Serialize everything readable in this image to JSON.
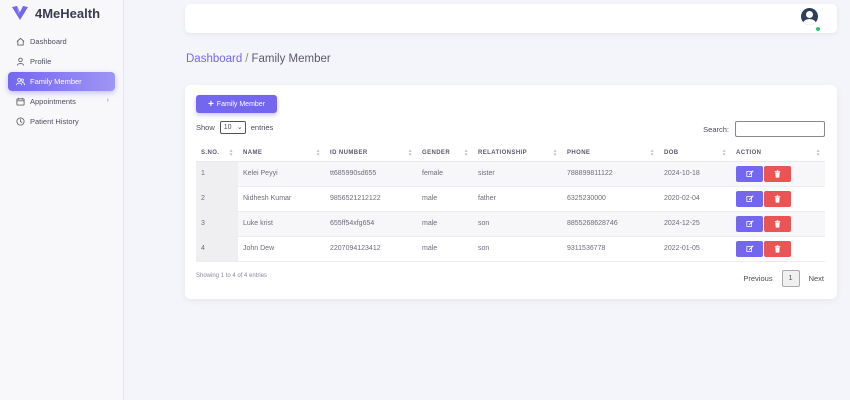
{
  "brand": {
    "name": "4MeHealth"
  },
  "sidebar": {
    "items": [
      {
        "label": "Dashboard",
        "icon": "home-icon"
      },
      {
        "label": "Profile",
        "icon": "user-icon"
      },
      {
        "label": "Family Member",
        "icon": "users-icon",
        "active": true
      },
      {
        "label": "Appointments",
        "icon": "calendar-icon",
        "has_submenu": true
      },
      {
        "label": "Patient History",
        "icon": "history-icon"
      }
    ]
  },
  "breadcrumb": {
    "parent": "Dashboard",
    "separator": "/",
    "current": "Family Member"
  },
  "toolbar": {
    "add_label": "Family Member"
  },
  "table_controls": {
    "show_label": "Show",
    "entries_value": "10",
    "entries_label": "entries",
    "search_label": "Search:",
    "search_value": ""
  },
  "table": {
    "columns": [
      "S.NO.",
      "NAME",
      "ID NUMBER",
      "GENDER",
      "RELATIONSHIP",
      "PHONE",
      "DOB",
      "ACTION"
    ],
    "rows": [
      {
        "sno": "1",
        "name": "Kelei Peyyi",
        "id_number": "tt685990sd655",
        "gender": "female",
        "relationship": "sister",
        "phone": "788899811122",
        "dob": "2024-10-18"
      },
      {
        "sno": "2",
        "name": "Nidhesh Kumar",
        "id_number": "9856521212122",
        "gender": "male",
        "relationship": "father",
        "phone": "6325230000",
        "dob": "2020-02-04"
      },
      {
        "sno": "3",
        "name": "Luke krist",
        "id_number": "655ff54xfg654",
        "gender": "male",
        "relationship": "son",
        "phone": "8855268628746",
        "dob": "2024-12-25"
      },
      {
        "sno": "4",
        "name": "John Dew",
        "id_number": "2207094123412",
        "gender": "male",
        "relationship": "son",
        "phone": "9311536778",
        "dob": "2022-01-05"
      }
    ]
  },
  "footer": {
    "info": "Showing 1 to 4 of 4 entries",
    "previous": "Previous",
    "current_page": "1",
    "next": "Next"
  },
  "colors": {
    "accent": "#7367f0",
    "danger": "#ea5455",
    "online": "#28c76f"
  }
}
